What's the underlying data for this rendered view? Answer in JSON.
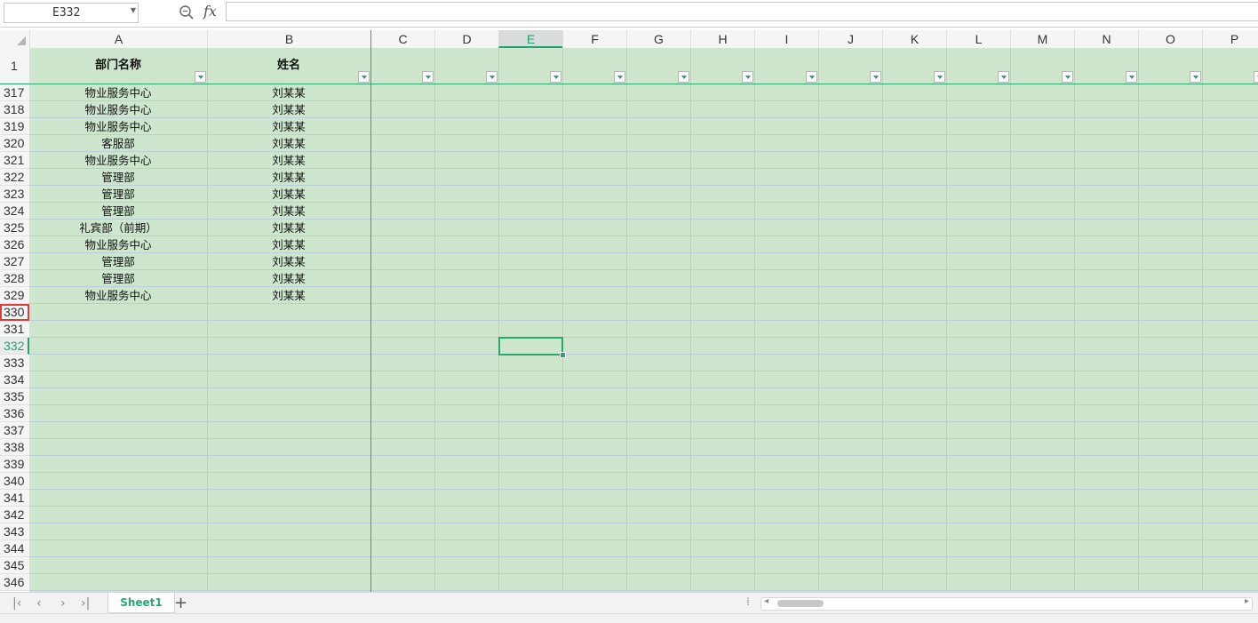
{
  "namebox": {
    "value": "E332"
  },
  "formula_bar": {
    "fx_label": "fx",
    "value": ""
  },
  "columns": [
    "A",
    "B",
    "C",
    "D",
    "E",
    "F",
    "G",
    "H",
    "I",
    "J",
    "K",
    "L",
    "M",
    "N",
    "O",
    "P"
  ],
  "selected_column": "E",
  "header_row": {
    "row_number": "1",
    "cells": [
      "部门名称",
      "姓名",
      "",
      "",
      "",
      "",
      "",
      "",
      "",
      "",
      "",
      "",
      "",
      "",
      "",
      ""
    ]
  },
  "rows": [
    {
      "num": "317",
      "dept": "物业服务中心",
      "name": "刘某某"
    },
    {
      "num": "318",
      "dept": "物业服务中心",
      "name": "刘某某"
    },
    {
      "num": "319",
      "dept": "物业服务中心",
      "name": "刘某某"
    },
    {
      "num": "320",
      "dept": "客服部",
      "name": "刘某某"
    },
    {
      "num": "321",
      "dept": "物业服务中心",
      "name": "刘某某"
    },
    {
      "num": "322",
      "dept": "管理部",
      "name": "刘某某"
    },
    {
      "num": "323",
      "dept": "管理部",
      "name": "刘某某"
    },
    {
      "num": "324",
      "dept": "管理部",
      "name": "刘某某"
    },
    {
      "num": "325",
      "dept": "礼宾部（前期）",
      "name": "刘某某"
    },
    {
      "num": "326",
      "dept": "物业服务中心",
      "name": "刘某某"
    },
    {
      "num": "327",
      "dept": "管理部",
      "name": "刘某某"
    },
    {
      "num": "328",
      "dept": "管理部",
      "name": "刘某某"
    },
    {
      "num": "329",
      "dept": "物业服务中心",
      "name": "刘某某"
    },
    {
      "num": "330",
      "dept": "",
      "name": ""
    },
    {
      "num": "331",
      "dept": "",
      "name": ""
    },
    {
      "num": "332",
      "dept": "",
      "name": ""
    },
    {
      "num": "333",
      "dept": "",
      "name": ""
    },
    {
      "num": "334",
      "dept": "",
      "name": ""
    },
    {
      "num": "335",
      "dept": "",
      "name": ""
    },
    {
      "num": "336",
      "dept": "",
      "name": ""
    },
    {
      "num": "337",
      "dept": "",
      "name": ""
    },
    {
      "num": "338",
      "dept": "",
      "name": ""
    },
    {
      "num": "339",
      "dept": "",
      "name": ""
    },
    {
      "num": "340",
      "dept": "",
      "name": ""
    },
    {
      "num": "341",
      "dept": "",
      "name": ""
    },
    {
      "num": "342",
      "dept": "",
      "name": ""
    },
    {
      "num": "343",
      "dept": "",
      "name": ""
    },
    {
      "num": "344",
      "dept": "",
      "name": ""
    },
    {
      "num": "345",
      "dept": "",
      "name": ""
    },
    {
      "num": "346",
      "dept": "",
      "name": ""
    }
  ],
  "selected_row": "332",
  "marked_row": "330",
  "sheet_tabs": [
    "Sheet1"
  ],
  "colors": {
    "grid_fill": "#cde6cd",
    "accent": "#2aa86f",
    "highlight_border": "#e03c3c"
  }
}
